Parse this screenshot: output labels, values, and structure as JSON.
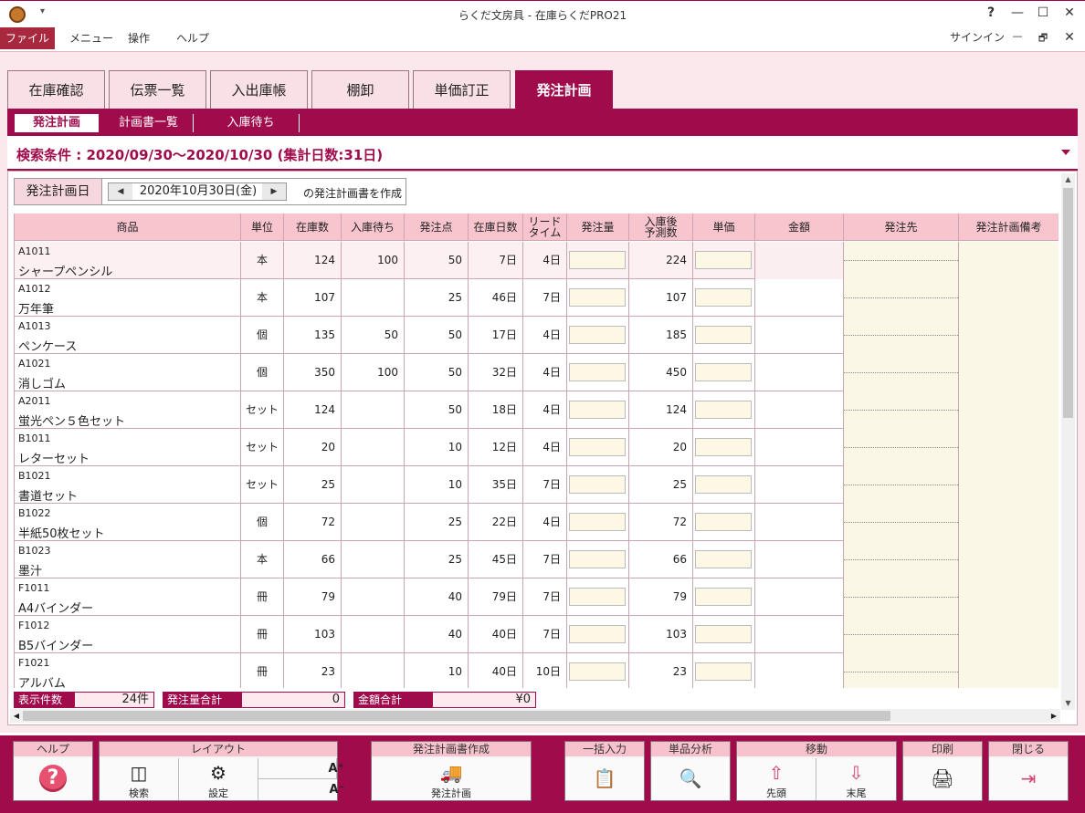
{
  "window": {
    "title": "らくだ文房具 - 在庫らくだPRO21",
    "quick_access": "▾",
    "help": "?",
    "minimize": "—",
    "maximize": "☐",
    "close": "✕"
  },
  "menu": {
    "file": "ファイル",
    "items": [
      "メニュー",
      "操作",
      "ヘルプ"
    ],
    "signin": "サインイン",
    "sub_min": "—",
    "sub_restore": "🗗",
    "sub_close": "✕"
  },
  "tabs": [
    "在庫確認",
    "伝票一覧",
    "入出庫帳",
    "棚卸",
    "単価訂正",
    "発注計画"
  ],
  "subtabs": [
    "発注計画",
    "計画書一覧",
    "入庫待ち"
  ],
  "condition": "検索条件 : 2020/09/30～2020/10/30 (集計日数:31日)",
  "dateform": {
    "label": "発注計画日",
    "value": "2020年10月30日(金)",
    "prev": "◀",
    "next": "▶",
    "suffix": "の発注計画書を作成"
  },
  "columns": [
    "商品",
    "単位",
    "在庫数",
    "入庫待ち",
    "発注点",
    "在庫日数",
    "リード\nタイム",
    "発注量",
    "入庫後\n予測数",
    "単価",
    "金額",
    "発注先",
    "発注計画備考"
  ],
  "rows": [
    {
      "code": "A1011",
      "name": "シャープペンシル",
      "unit": "本",
      "stock": "124",
      "waiting": "100",
      "point": "50",
      "days": "7日",
      "lead": "4日",
      "forecast": "224"
    },
    {
      "code": "A1012",
      "name": "万年筆",
      "unit": "本",
      "stock": "107",
      "waiting": "",
      "point": "25",
      "days": "46日",
      "lead": "7日",
      "forecast": "107"
    },
    {
      "code": "A1013",
      "name": "ペンケース",
      "unit": "個",
      "stock": "135",
      "waiting": "50",
      "point": "50",
      "days": "17日",
      "lead": "4日",
      "forecast": "185"
    },
    {
      "code": "A1021",
      "name": "消しゴム",
      "unit": "個",
      "stock": "350",
      "waiting": "100",
      "point": "50",
      "days": "32日",
      "lead": "4日",
      "forecast": "450"
    },
    {
      "code": "A2011",
      "name": "蛍光ペン５色セット",
      "unit": "セット",
      "stock": "124",
      "waiting": "",
      "point": "50",
      "days": "18日",
      "lead": "4日",
      "forecast": "124"
    },
    {
      "code": "B1011",
      "name": "レターセット",
      "unit": "セット",
      "stock": "20",
      "waiting": "",
      "point": "10",
      "days": "12日",
      "lead": "4日",
      "forecast": "20"
    },
    {
      "code": "B1021",
      "name": "書道セット",
      "unit": "セット",
      "stock": "25",
      "waiting": "",
      "point": "10",
      "days": "35日",
      "lead": "7日",
      "forecast": "25"
    },
    {
      "code": "B1022",
      "name": "半紙50枚セット",
      "unit": "個",
      "stock": "72",
      "waiting": "",
      "point": "25",
      "days": "22日",
      "lead": "4日",
      "forecast": "72"
    },
    {
      "code": "B1023",
      "name": "墨汁",
      "unit": "本",
      "stock": "66",
      "waiting": "",
      "point": "25",
      "days": "45日",
      "lead": "7日",
      "forecast": "66"
    },
    {
      "code": "F1011",
      "name": "A4バインダー",
      "unit": "冊",
      "stock": "79",
      "waiting": "",
      "point": "40",
      "days": "79日",
      "lead": "7日",
      "forecast": "79"
    },
    {
      "code": "F1012",
      "name": "B5バインダー",
      "unit": "冊",
      "stock": "103",
      "waiting": "",
      "point": "40",
      "days": "40日",
      "lead": "7日",
      "forecast": "103"
    },
    {
      "code": "F1021",
      "name": "アルバム",
      "unit": "冊",
      "stock": "23",
      "waiting": "",
      "point": "10",
      "days": "40日",
      "lead": "10日",
      "forecast": "23"
    }
  ],
  "totals": {
    "count_label": "表示件数",
    "count": "24件",
    "qty_label": "発注量合計",
    "qty": "0",
    "amount_label": "金額合計",
    "amount": "¥0"
  },
  "toolbar": {
    "help": {
      "title": "ヘルプ"
    },
    "layout": {
      "title": "レイアウト",
      "search": "検索",
      "settings": "設定",
      "font_up": "A⁺",
      "font_down": "A⁻"
    },
    "plan": {
      "title": "発注計画書作成",
      "label": "発注計画"
    },
    "bulk": {
      "title": "一括入力"
    },
    "analysis": {
      "title": "単品分析"
    },
    "move": {
      "title": "移動",
      "first": "先頭",
      "last": "末尾"
    },
    "print": {
      "title": "印刷"
    },
    "close": {
      "title": "閉じる"
    }
  }
}
